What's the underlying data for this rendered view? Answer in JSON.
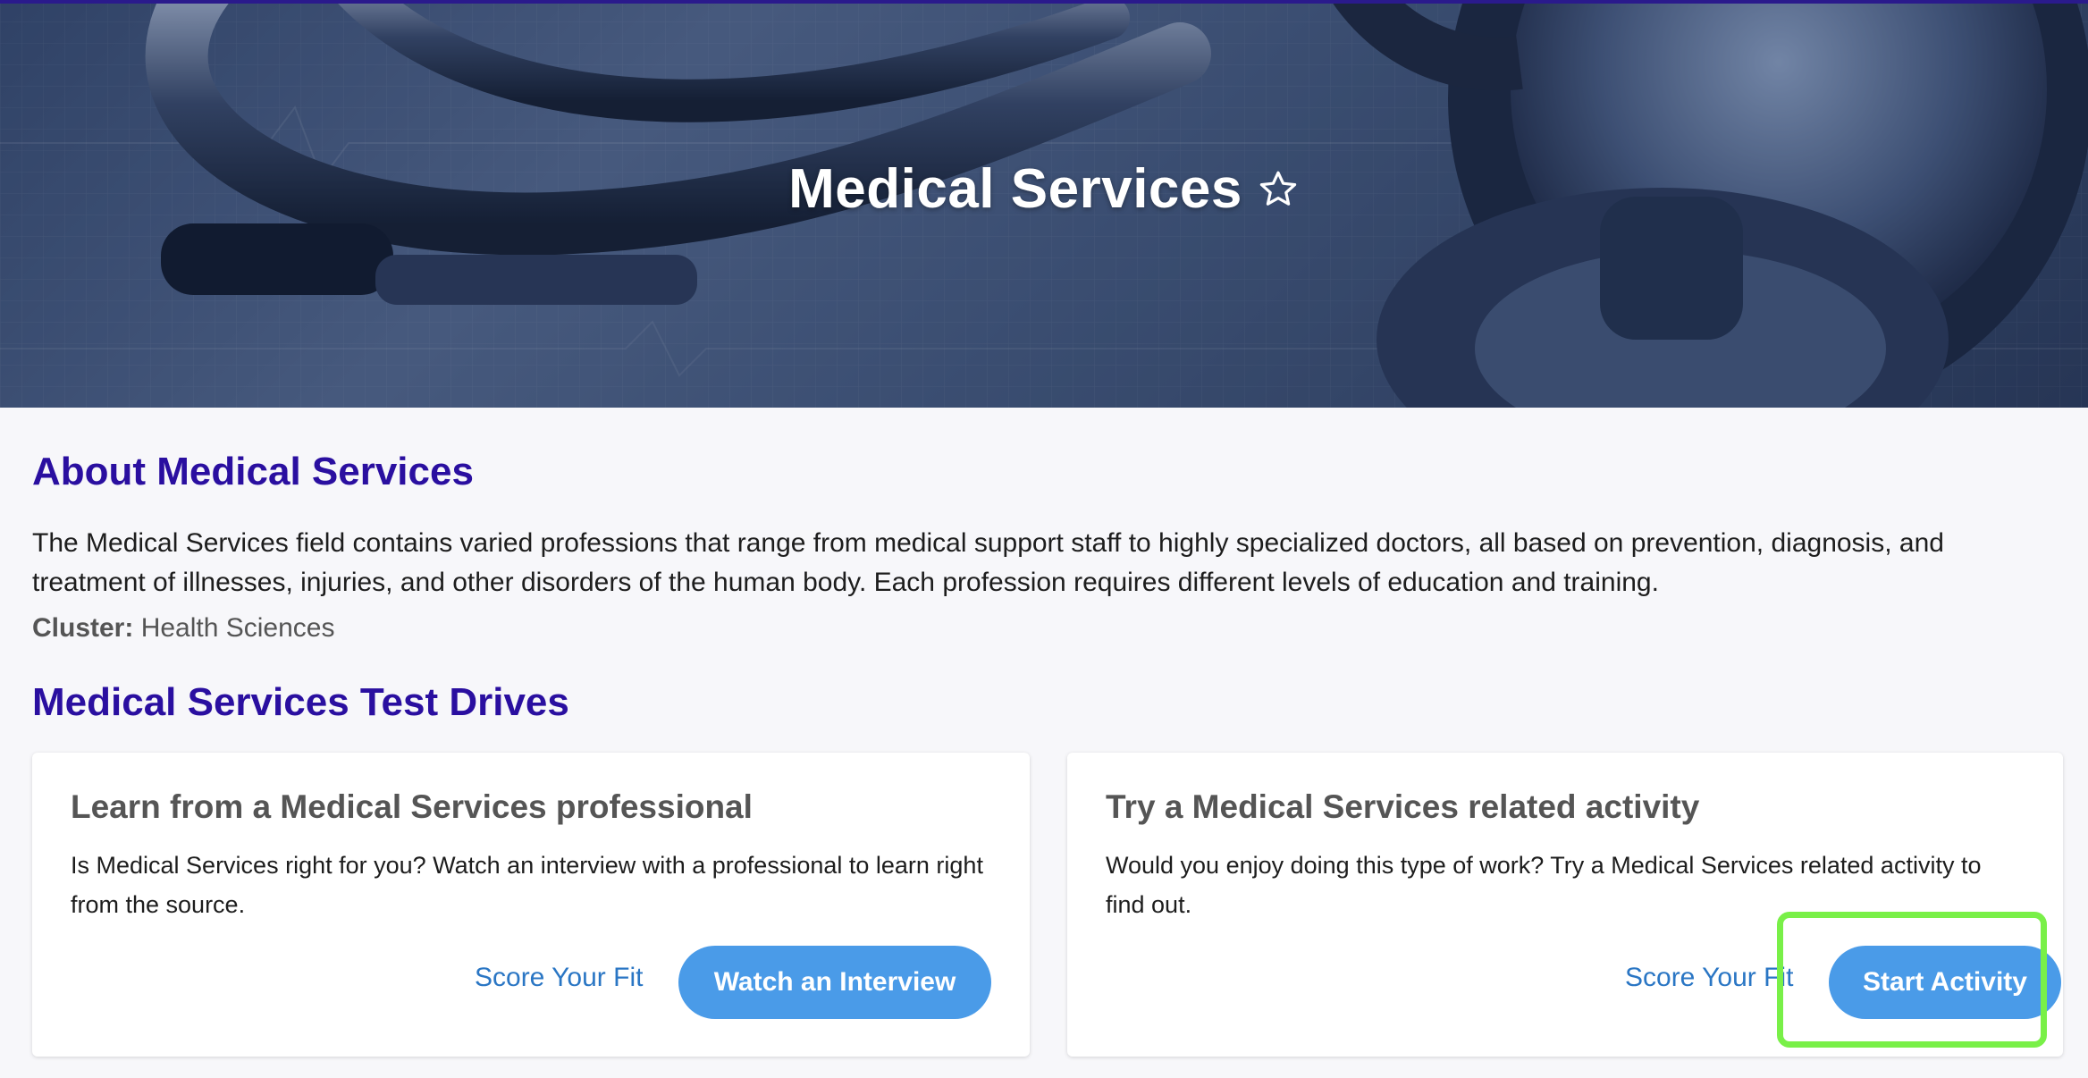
{
  "hero": {
    "title": "Medical Services",
    "favorite_icon": "star-outline-icon"
  },
  "about": {
    "heading": "About Medical Services",
    "description": "The Medical Services field contains varied professions that range from medical support staff to highly specialized doctors, all based on prevention, diagnosis, and treatment of illnesses, injuries, and other disorders of the human body. Each profession requires different levels of education and training.",
    "cluster_label": "Cluster:",
    "cluster_value": "Health Sciences"
  },
  "test_drives": {
    "heading": "Medical Services Test Drives",
    "cards": [
      {
        "title": "Learn from a Medical Services professional",
        "text": "Is Medical Services right for you? Watch an interview with a professional to learn right from the source.",
        "link_label": "Score Your Fit",
        "button_label": "Watch an Interview"
      },
      {
        "title": "Try a Medical Services related activity",
        "text": "Would you enjoy doing this type of work? Try a Medical Services related activity to find out.",
        "link_label": "Score Your Fit",
        "button_label": "Start Activity"
      }
    ]
  },
  "colors": {
    "heading": "#2a0fa0",
    "button": "#4a9be8",
    "link": "#2a76c4",
    "highlight": "#79f048"
  }
}
